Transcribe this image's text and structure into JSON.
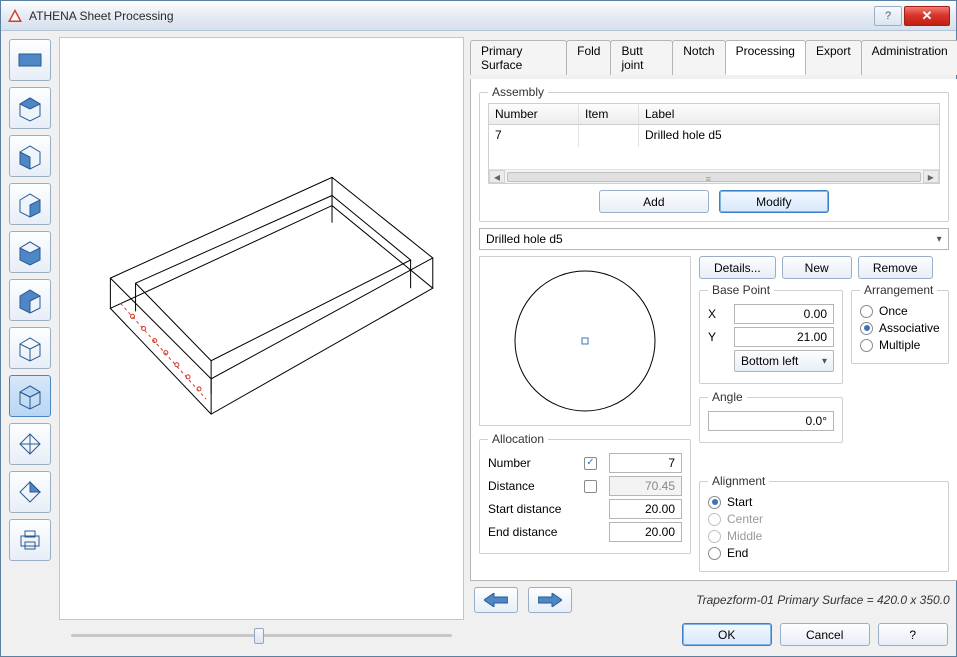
{
  "window": {
    "title": "ATHENA Sheet Processing"
  },
  "tabs": {
    "items": [
      {
        "label": "Primary Surface"
      },
      {
        "label": "Fold"
      },
      {
        "label": "Butt joint"
      },
      {
        "label": "Notch"
      },
      {
        "label": "Processing"
      },
      {
        "label": "Export"
      },
      {
        "label": "Administration"
      }
    ],
    "active_index": 4
  },
  "assembly": {
    "legend": "Assembly",
    "headers": {
      "number": "Number",
      "item": "Item",
      "label": "Label"
    },
    "rows": [
      {
        "number": "7",
        "item": "",
        "label": "Drilled hole d5"
      }
    ],
    "add_label": "Add",
    "modify_label": "Modify"
  },
  "selected_operation": "Drilled hole d5",
  "buttons": {
    "details": "Details...",
    "new": "New",
    "remove": "Remove",
    "ok": "OK",
    "cancel": "Cancel",
    "help": "?"
  },
  "base_point": {
    "legend": "Base Point",
    "x_label": "X",
    "x_value": "0.00",
    "y_label": "Y",
    "y_value": "21.00",
    "anchor": "Bottom left"
  },
  "arrangement": {
    "legend": "Arrangement",
    "options": {
      "once": "Once",
      "associative": "Associative",
      "multiple": "Multiple"
    },
    "selected": "associative"
  },
  "angle": {
    "legend": "Angle",
    "value": "0.0°"
  },
  "allocation": {
    "legend": "Allocation",
    "number_label": "Number",
    "number_value": "7",
    "number_checked": true,
    "distance_label": "Distance",
    "distance_value": "70.45",
    "distance_checked": false,
    "start_label": "Start distance",
    "start_value": "20.00",
    "end_label": "End distance",
    "end_value": "20.00"
  },
  "alignment": {
    "legend": "Alignment",
    "options": {
      "start": "Start",
      "center": "Center",
      "middle": "Middle",
      "end": "End"
    },
    "selected": "start",
    "disabled": [
      "center",
      "middle"
    ]
  },
  "status": "Trapezform-01 Primary Surface = 420.0 x 350.0",
  "toolbar": {
    "items": [
      "plane",
      "cube-front",
      "cube-top",
      "cube-bottom",
      "cube-left",
      "cube-right",
      "cube-transparent",
      "cube-transparent-active",
      "diamond",
      "diamond-alt",
      "print"
    ],
    "active_index": 7
  }
}
